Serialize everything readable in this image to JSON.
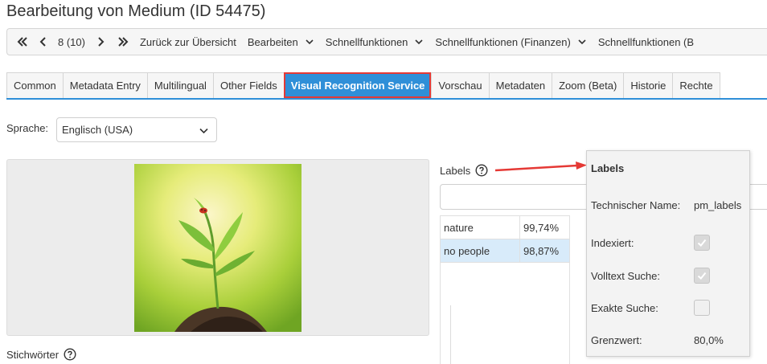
{
  "page": {
    "title": "Bearbeitung von Medium (ID 54475)"
  },
  "toolbar": {
    "counter": "8 (10)",
    "back_label": "Zurück zur Übersicht",
    "edit_label": "Bearbeiten",
    "quick_label": "Schnellfunktionen",
    "quick_fin_label": "Schnellfunktionen (Finanzen)",
    "quick_b_label": "Schnellfunktionen (B"
  },
  "tabs": [
    {
      "label": "Common"
    },
    {
      "label": "Metadata Entry"
    },
    {
      "label": "Multilingual"
    },
    {
      "label": "Other Fields"
    },
    {
      "label": "Visual Recognition Service",
      "active": true
    },
    {
      "label": "Vorschau"
    },
    {
      "label": "Metadaten"
    },
    {
      "label": "Zoom (Beta)"
    },
    {
      "label": "Historie"
    },
    {
      "label": "Rechte"
    }
  ],
  "language": {
    "label": "Sprache:",
    "selected": "Englisch (USA)"
  },
  "keywords": {
    "label": "Stichwörter"
  },
  "labels": {
    "heading": "Labels",
    "input_value": "",
    "rows": [
      {
        "name": "nature",
        "value": "99,74%",
        "selected": false
      },
      {
        "name": "no people",
        "value": "98,87%",
        "selected": true
      }
    ]
  },
  "tooltip": {
    "title": "Labels",
    "tech_name_label": "Technischer Name:",
    "tech_name_value": "pm_labels",
    "indexed_label": "Indexiert:",
    "indexed": true,
    "fulltext_label": "Volltext Suche:",
    "fulltext": true,
    "exact_label": "Exakte Suche:",
    "exact": false,
    "threshold_label": "Grenzwert:",
    "threshold_value": "80,0%"
  },
  "icons": {
    "first": "double-chevron-left-icon",
    "prev": "chevron-left-icon",
    "next": "chevron-right-icon",
    "last": "double-chevron-right-icon",
    "dropdown": "chevron-down-icon",
    "help": "help-circle-icon",
    "check": "checkmark-icon"
  },
  "colors": {
    "accent": "#2f8fd8",
    "highlight": "#e53935",
    "selected_row": "#d8ebfa"
  }
}
